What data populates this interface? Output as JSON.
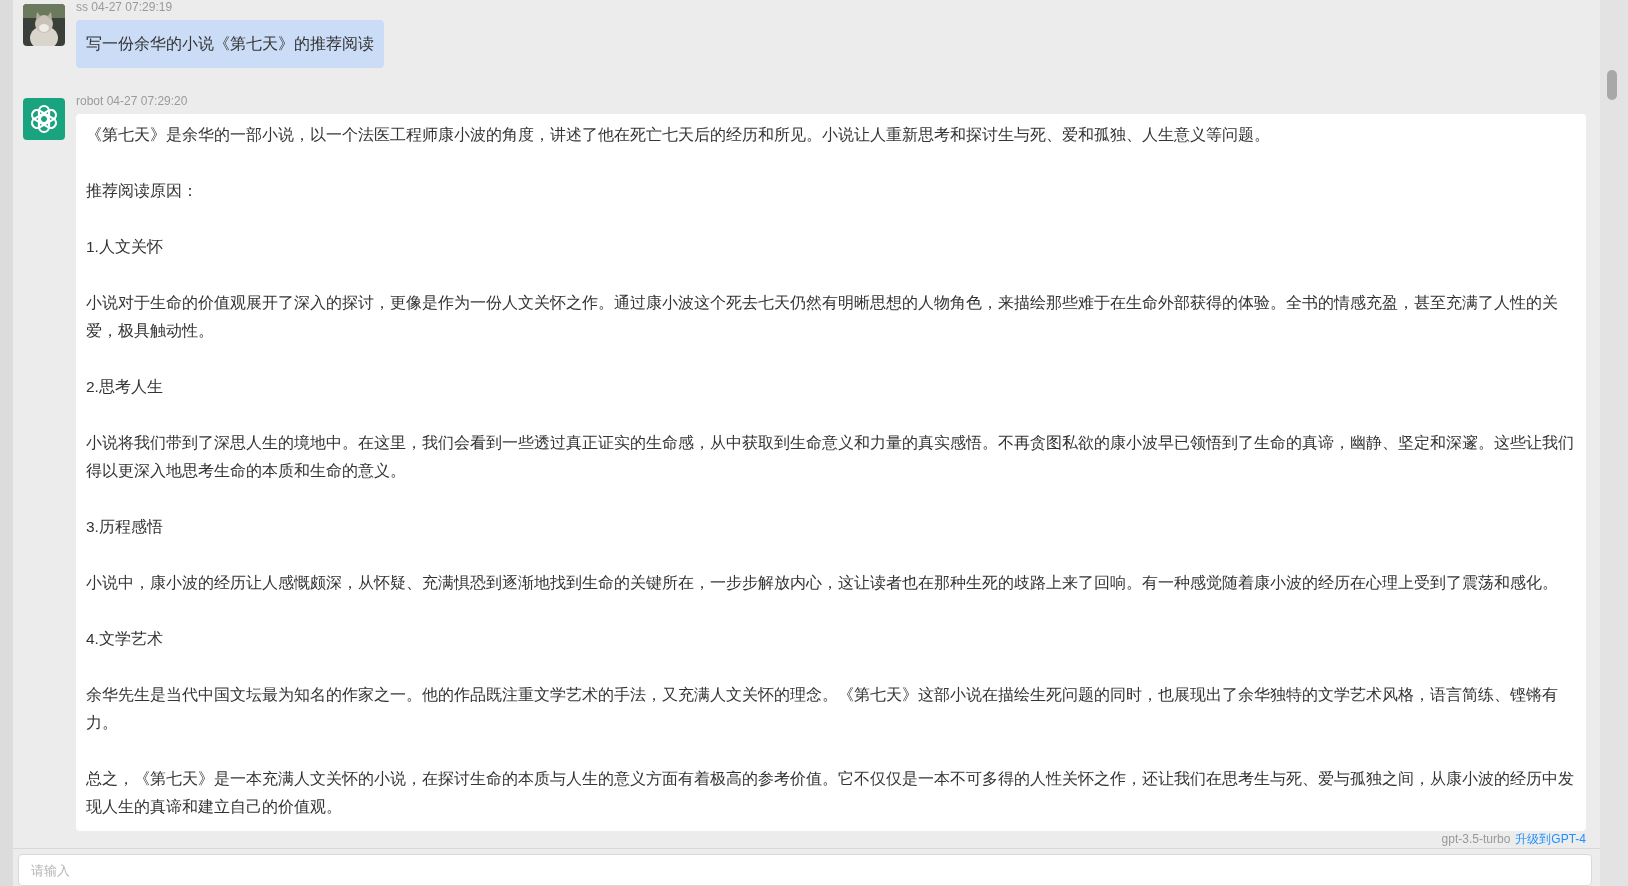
{
  "messages": [
    {
      "kind": "user",
      "sender": "ss",
      "time": "04-27 07:29:19",
      "paragraphs": [
        "写一份余华的小说《第七天》的推荐阅读"
      ]
    },
    {
      "kind": "bot",
      "sender": "robot",
      "time": "04-27 07:29:20",
      "paragraphs": [
        "《第七天》是余华的一部小说，以一个法医工程师康小波的角度，讲述了他在死亡七天后的经历和所见。小说让人重新思考和探讨生与死、爱和孤独、人生意义等问题。",
        "推荐阅读原因：",
        "1.人文关怀",
        "小说对于生命的价值观展开了深入的探讨，更像是作为一份人文关怀之作。通过康小波这个死去七天仍然有明晰思想的人物角色，来描绘那些难于在生命外部获得的体验。全书的情感充盈，甚至充满了人性的关爱，极具触动性。",
        "2.思考人生",
        "小说将我们带到了深思人生的境地中。在这里，我们会看到一些透过真正证实的生命感，从中获取到生命意义和力量的真实感悟。不再贪图私欲的康小波早已领悟到了生命的真谛，幽静、坚定和深邃。这些让我们得以更深入地思考生命的本质和生命的意义。",
        "3.历程感悟",
        "小说中，康小波的经历让人感慨颇深，从怀疑、充满惧恐到逐渐地找到生命的关键所在，一步步解放内心，这让读者也在那种生死的歧路上来了回响。有一种感觉随着康小波的经历在心理上受到了震荡和感化。",
        "4.文学艺术",
        "余华先生是当代中国文坛最为知名的作家之一。他的作品既注重文学艺术的手法，又充满人文关怀的理念。《第七天》这部小说在描绘生死问题的同时，也展现出了余华独特的文学艺术风格，语言简练、铿锵有力。",
        "总之，《第七天》是一本充满人文关怀的小说，在探讨生命的本质与人生的意义方面有着极高的参考价值。它不仅仅是一本不可多得的人性关怀之作，还让我们在思考生与死、爱与孤独之间，从康小波的经历中发现人生的真谛和建立自己的价值观。"
      ]
    }
  ],
  "footer": {
    "model": "gpt-3.5-turbo",
    "upgrade_link": "升级到GPT-4"
  },
  "input": {
    "placeholder": "请输入"
  }
}
